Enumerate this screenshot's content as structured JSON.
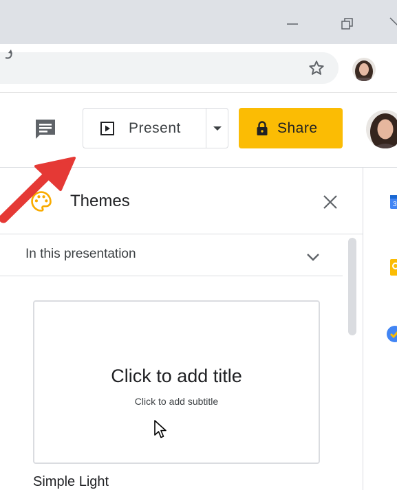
{
  "browser": {
    "window_controls": [
      "minimize-icon",
      "restore-icon",
      "close-icon"
    ],
    "address_bar": {
      "value": "",
      "star_icon": "star-icon"
    }
  },
  "header": {
    "present_label": "Present",
    "share_label": "Share",
    "share_color": "#fbbc04"
  },
  "themes_panel": {
    "title": "Themes",
    "section_label": "In this presentation",
    "theme": {
      "preview_title": "Click to add title",
      "preview_subtitle": "Click to add subtitle",
      "name": "Simple Light"
    }
  },
  "side_panel": {
    "icons": [
      "calendar-icon",
      "keep-icon",
      "tasks-icon"
    ]
  },
  "annotation": {
    "arrow_color": "#e53935"
  }
}
